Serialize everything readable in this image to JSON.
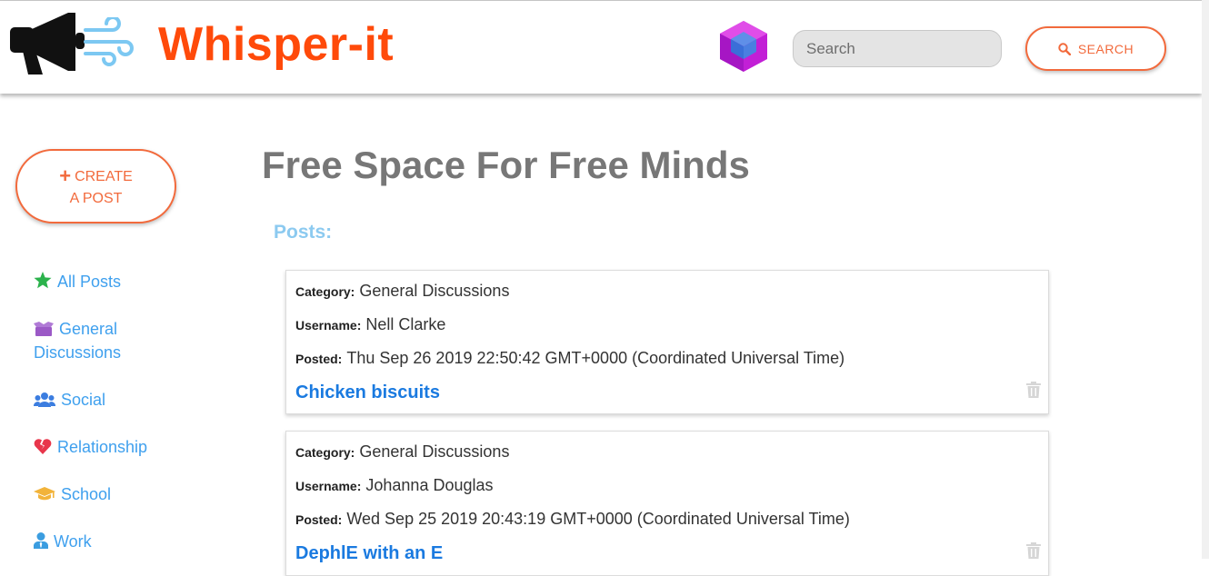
{
  "header": {
    "brand": "Whisper-it",
    "search_placeholder": "Search",
    "search_button": "SEARCH",
    "brand_color": "#ff4a0a"
  },
  "sidebar": {
    "create_button_line1": "CREATE",
    "create_button_line2": "A POST",
    "items": [
      {
        "label": "All Posts",
        "icon": "star-icon",
        "color": "#2bb24c"
      },
      {
        "label": "General Discussions",
        "icon": "box-icon",
        "color": "#9b59c6"
      },
      {
        "label": "Social",
        "icon": "users-icon",
        "color": "#3b7de0"
      },
      {
        "label": "Relationship",
        "icon": "broken-heart-icon",
        "color": "#e8364b"
      },
      {
        "label": "School",
        "icon": "graduation-cap-icon",
        "color": "#f2b33a"
      },
      {
        "label": "Work",
        "icon": "user-tie-icon",
        "color": "#3b9de0"
      }
    ]
  },
  "main": {
    "headline": "Free Space For Free Minds",
    "posts_label": "Posts:",
    "posts": [
      {
        "category_label": "Category:",
        "category": "General Discussions",
        "username_label": "Username:",
        "username": "Nell Clarke",
        "posted_label": "Posted:",
        "posted": "Thu Sep 26 2019 22:50:42 GMT+0000 (Coordinated Universal Time)",
        "title": "Chicken biscuits"
      },
      {
        "category_label": "Category:",
        "category": "General Discussions",
        "username_label": "Username:",
        "username": "Johanna Douglas",
        "posted_label": "Posted:",
        "posted": "Wed Sep 25 2019 20:43:19 GMT+0000 (Coordinated Universal Time)",
        "title": "DephlE with an E"
      }
    ]
  },
  "colors": {
    "accent": "#f26a3c",
    "link": "#3fa0ee",
    "post_title": "#1a7ae0"
  }
}
